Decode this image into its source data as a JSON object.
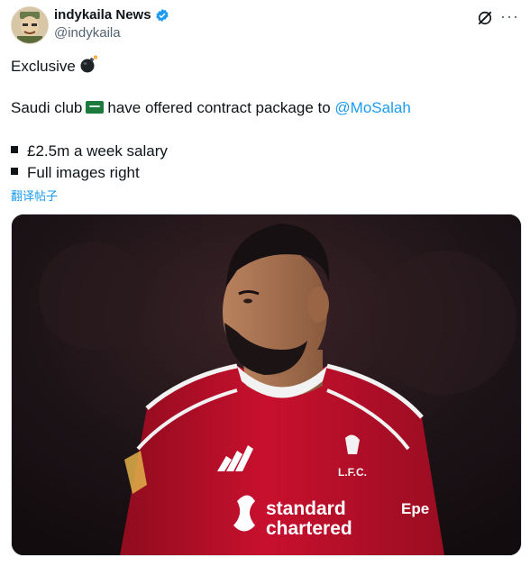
{
  "author": {
    "name": "indykaila News",
    "handle": "@indykaila",
    "verified": true
  },
  "icons": {
    "avatar": "avatar-illustration",
    "verified": "verified-badge-icon",
    "grok": "grok-icon",
    "more": "more-options-icon",
    "bomb": "bomb-emoji",
    "flag": "saudi-flag-emoji"
  },
  "tweet": {
    "line1": "Exclusive",
    "line2_prefix": "Saudi club",
    "line2_middle": "have offered contract package to",
    "mention": "@MoSalah",
    "bullets": [
      "£2.5m a week salary",
      "Full images right"
    ],
    "translate_label": "翻译帖子"
  },
  "media": {
    "shirt_sponsor_line1": "standard",
    "shirt_sponsor_line2": "chartered",
    "crest_text": "L.F.C.",
    "sleeve_text": "Epe"
  },
  "colors": {
    "mention": "#1d9bf0",
    "verified": "#1d9bf0",
    "shirt": "#c8102e"
  }
}
